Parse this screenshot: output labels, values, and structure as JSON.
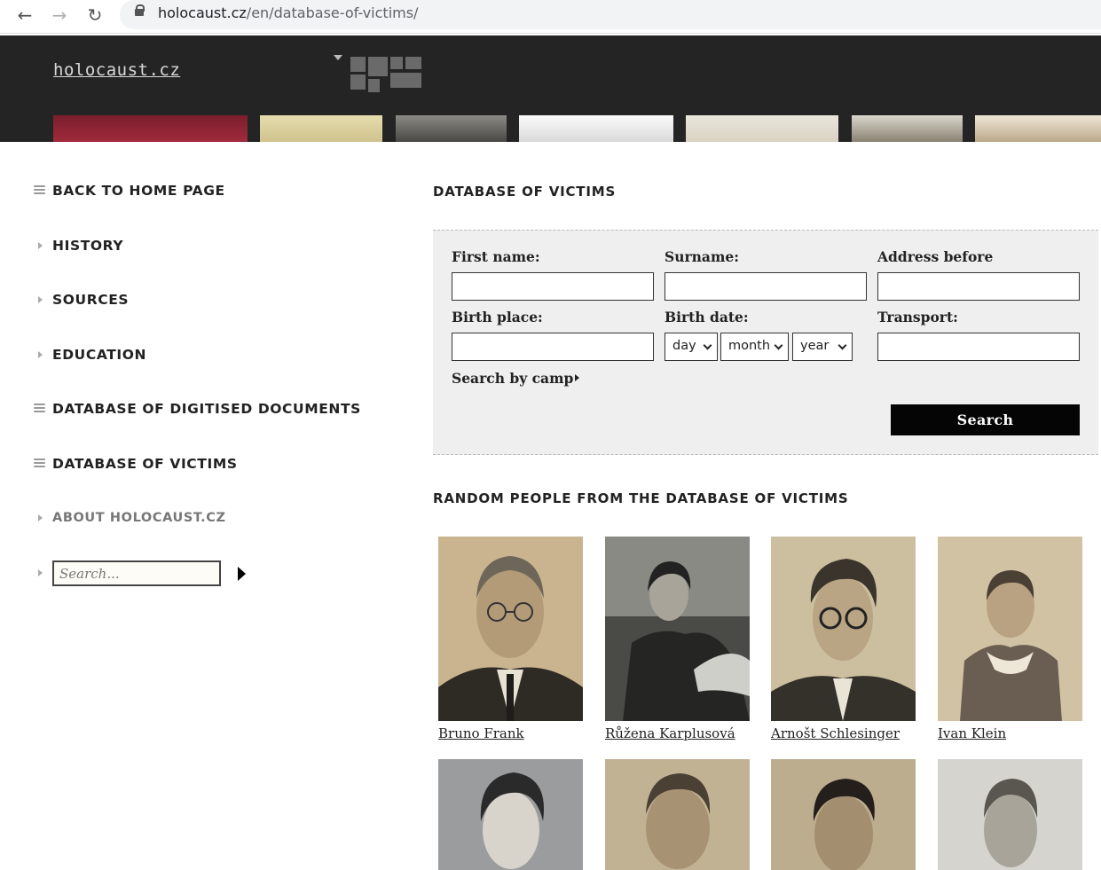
{
  "browser": {
    "back_icon": "←",
    "forward_icon": "→",
    "reload_icon": "↻",
    "url_host": "holocaust.cz",
    "url_path": "/en/database-of-victims/"
  },
  "header": {
    "logo": "holocaust.cz"
  },
  "sidebar": {
    "items": [
      {
        "label": "BACK TO HOME PAGE",
        "icon": "list-icon"
      },
      {
        "label": "HISTORY",
        "icon": "triangle-icon"
      },
      {
        "label": "SOURCES",
        "icon": "triangle-icon"
      },
      {
        "label": "EDUCATION",
        "icon": "triangle-icon"
      },
      {
        "label": "DATABASE OF DIGITISED DOCUMENTS",
        "icon": "list-icon"
      },
      {
        "label": "DATABASE OF VICTIMS",
        "icon": "list-icon"
      },
      {
        "label": "ABOUT HOLOCAUST.CZ",
        "icon": "triangle-icon"
      }
    ],
    "search_placeholder": "Search..."
  },
  "main": {
    "title": "DATABASE OF VICTIMS",
    "form": {
      "first_name_label": "First name:",
      "surname_label": "Surname:",
      "address_label": "Address before",
      "birth_place_label": "Birth place:",
      "birth_date_label": "Birth date:",
      "transport_label": "Transport:",
      "day": "day",
      "month": "month",
      "year": "year",
      "search_by_camp": "Search by camp",
      "search_button": "Search"
    },
    "random_title": "RANDOM PEOPLE FROM THE DATABASE OF VICTIMS",
    "people": [
      {
        "name": "Bruno Frank"
      },
      {
        "name": "Růžena Karplusová"
      },
      {
        "name": "Arnošt Schlesinger"
      },
      {
        "name": "Ivan Klein"
      },
      {
        "name": ""
      },
      {
        "name": ""
      },
      {
        "name": ""
      },
      {
        "name": ""
      }
    ]
  },
  "colors": {
    "header_bg": "#242424",
    "panel_bg": "#efefef",
    "button_bg": "#050505",
    "photo_sepia": "#c9b48f"
  }
}
